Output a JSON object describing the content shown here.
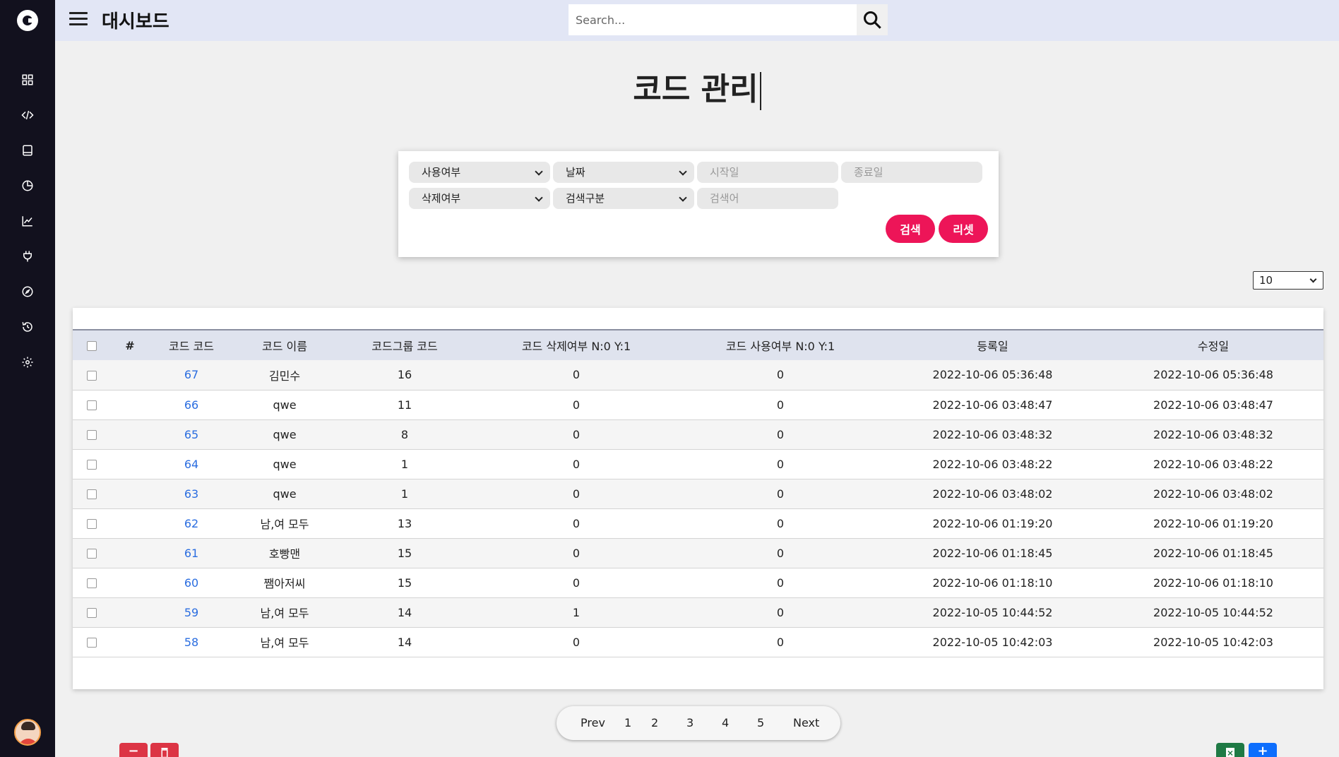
{
  "topbar": {
    "title": "대시보드",
    "search_placeholder": "Search..."
  },
  "sidebar": {
    "icons": [
      "dashboard-icon",
      "code-icon",
      "book-icon",
      "pie-chart-icon",
      "line-chart-icon",
      "plug-icon",
      "compass-icon",
      "history-icon",
      "gear-icon"
    ]
  },
  "page": {
    "title": "코드 관리"
  },
  "filters": {
    "use_status": "사용여부",
    "date": "날짜",
    "start_date_placeholder": "시작일",
    "end_date_placeholder": "종료일",
    "delete_status": "삭제여부",
    "search_type": "검색구분",
    "keyword_placeholder": "검색어",
    "search_label": "검색",
    "reset_label": "리셋"
  },
  "page_size": "10",
  "table": {
    "headers": [
      "#",
      "코드 코드",
      "코드 이름",
      "코드그룹 코드",
      "코드 삭제여부 N:0 Y:1",
      "코드 사용여부 N:0 Y:1",
      "등록일",
      "수정일"
    ],
    "rows": [
      {
        "code": "67",
        "name": "김민수",
        "group": "16",
        "deleted": "0",
        "used": "0",
        "created": "2022-10-06 05:36:48",
        "updated": "2022-10-06 05:36:48"
      },
      {
        "code": "66",
        "name": "qwe",
        "group": "11",
        "deleted": "0",
        "used": "0",
        "created": "2022-10-06 03:48:47",
        "updated": "2022-10-06 03:48:47"
      },
      {
        "code": "65",
        "name": "qwe",
        "group": "8",
        "deleted": "0",
        "used": "0",
        "created": "2022-10-06 03:48:32",
        "updated": "2022-10-06 03:48:32"
      },
      {
        "code": "64",
        "name": "qwe",
        "group": "1",
        "deleted": "0",
        "used": "0",
        "created": "2022-10-06 03:48:22",
        "updated": "2022-10-06 03:48:22"
      },
      {
        "code": "63",
        "name": "qwe",
        "group": "1",
        "deleted": "0",
        "used": "0",
        "created": "2022-10-06 03:48:02",
        "updated": "2022-10-06 03:48:02"
      },
      {
        "code": "62",
        "name": "남,여 모두",
        "group": "13",
        "deleted": "0",
        "used": "0",
        "created": "2022-10-06 01:19:20",
        "updated": "2022-10-06 01:19:20"
      },
      {
        "code": "61",
        "name": "호빵맨",
        "group": "15",
        "deleted": "0",
        "used": "0",
        "created": "2022-10-06 01:18:45",
        "updated": "2022-10-06 01:18:45"
      },
      {
        "code": "60",
        "name": "쨈아저씨",
        "group": "15",
        "deleted": "0",
        "used": "0",
        "created": "2022-10-06 01:18:10",
        "updated": "2022-10-06 01:18:10"
      },
      {
        "code": "59",
        "name": "남,여 모두",
        "group": "14",
        "deleted": "1",
        "used": "0",
        "created": "2022-10-05 10:44:52",
        "updated": "2022-10-05 10:44:52"
      },
      {
        "code": "58",
        "name": "남,여 모두",
        "group": "14",
        "deleted": "0",
        "used": "0",
        "created": "2022-10-05 10:42:03",
        "updated": "2022-10-05 10:42:03"
      }
    ]
  },
  "pagination": {
    "prev": "Prev",
    "pages": [
      "1",
      "2",
      "3",
      "4",
      "5"
    ],
    "next": "Next"
  },
  "actions": {
    "remove_label": "−",
    "add_label": "+"
  },
  "colors": {
    "sidebar_bg": "#12111e",
    "topbar_bg": "#e2e6f5",
    "accent_pink": "#ed1558",
    "link_blue": "#2a6de0",
    "danger_red": "#dc3545",
    "excel_green": "#1f7a45",
    "primary_blue": "#0d6efd"
  }
}
